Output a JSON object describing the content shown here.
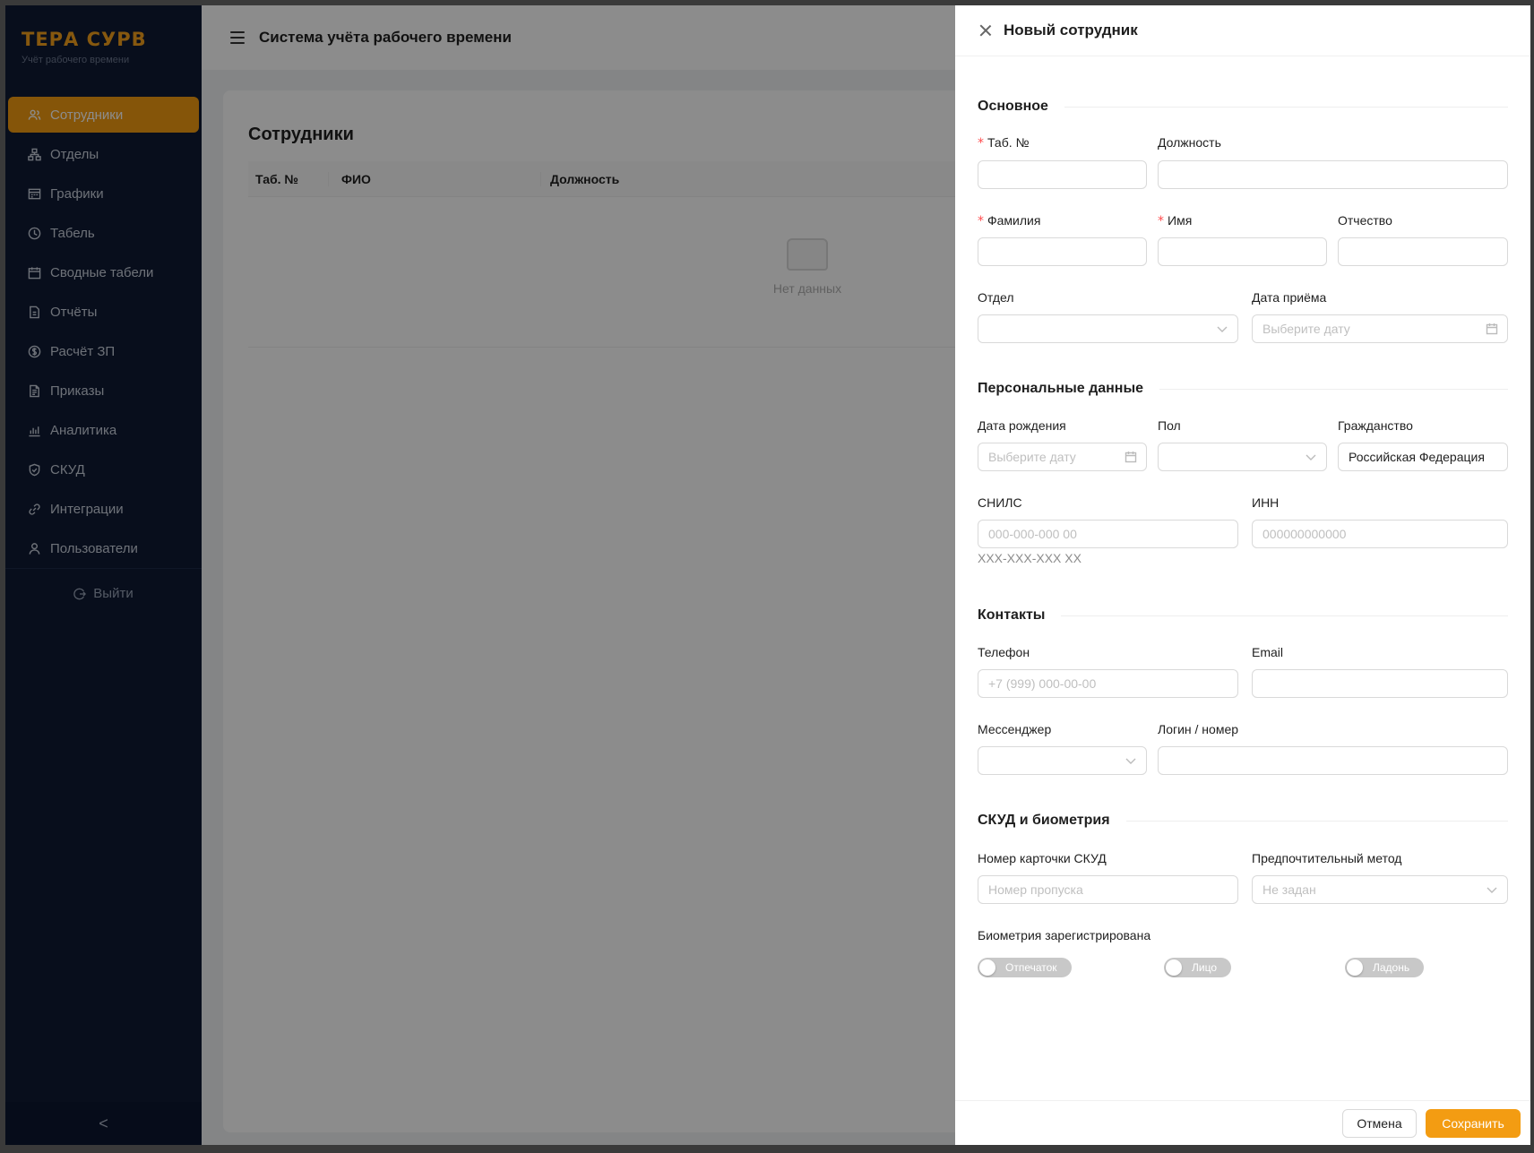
{
  "brand": {
    "title": "ТЕРА СУРВ",
    "subtitle": "Учёт рабочего времени"
  },
  "sidebar": {
    "items": [
      {
        "label": "Сотрудники",
        "icon": "team-icon",
        "active": true
      },
      {
        "label": "Отделы",
        "icon": "org-chart-icon"
      },
      {
        "label": "Графики",
        "icon": "schedule-icon"
      },
      {
        "label": "Табель",
        "icon": "clock-icon"
      },
      {
        "label": "Сводные табели",
        "icon": "calendar-icon"
      },
      {
        "label": "Отчёты",
        "icon": "report-icon"
      },
      {
        "label": "Расчёт ЗП",
        "icon": "dollar-icon"
      },
      {
        "label": "Приказы",
        "icon": "document-icon"
      },
      {
        "label": "Аналитика",
        "icon": "bar-chart-icon"
      },
      {
        "label": "СКУД",
        "icon": "shield-icon"
      },
      {
        "label": "Интеграции",
        "icon": "api-icon"
      },
      {
        "label": "Пользователи",
        "icon": "user-icon"
      }
    ],
    "logout_label": "Выйти",
    "collapse_glyph": "<"
  },
  "header": {
    "title": "Система учёта рабочего времени"
  },
  "page": {
    "title": "Сотрудники",
    "columns": [
      "Таб. №",
      "ФИО",
      "Должность"
    ],
    "empty_text": "Нет данных"
  },
  "drawer": {
    "title": "Новый сотрудник",
    "sections": {
      "basic": "Основное",
      "personal": "Персональные данные",
      "contacts": "Контакты",
      "access": "СКУД и биометрия"
    },
    "fields": {
      "tab_no": {
        "label": "Таб. №",
        "value": ""
      },
      "position": {
        "label": "Должность",
        "value": ""
      },
      "last_name": {
        "label": "Фамилия",
        "value": ""
      },
      "first_name": {
        "label": "Имя",
        "value": ""
      },
      "middle_name": {
        "label": "Отчество",
        "value": ""
      },
      "department": {
        "label": "Отдел",
        "value": ""
      },
      "hire_date": {
        "label": "Дата приёма",
        "placeholder": "Выберите дату"
      },
      "birth_date": {
        "label": "Дата рождения",
        "placeholder": "Выберите дату"
      },
      "gender": {
        "label": "Пол",
        "value": ""
      },
      "citizenship": {
        "label": "Гражданство",
        "value": "Российская Федерация"
      },
      "snils": {
        "label": "СНИЛС",
        "placeholder": "000-000-000 00",
        "hint": "XXX-XXX-XXX XX"
      },
      "inn": {
        "label": "ИНН",
        "placeholder": "000000000000"
      },
      "phone": {
        "label": "Телефон",
        "placeholder": "+7 (999) 000-00-00"
      },
      "email": {
        "label": "Email",
        "value": ""
      },
      "messenger": {
        "label": "Мессенджер",
        "value": ""
      },
      "login": {
        "label": "Логин / номер",
        "value": ""
      },
      "card_no": {
        "label": "Номер карточки СКУД",
        "placeholder": "Номер пропуска"
      },
      "method": {
        "label": "Предпочтительный метод",
        "placeholder": "Не задан"
      },
      "biometrics": {
        "label": "Биометрия зарегистрирована",
        "fingerprint": "Отпечаток",
        "face": "Лицо",
        "palm": "Ладонь"
      }
    },
    "buttons": {
      "cancel": "Отмена",
      "save": "Сохранить"
    }
  },
  "colors": {
    "accent": "#f39c12",
    "sidebar_bg": "#0f1b33",
    "required": "#ff4d4f"
  }
}
